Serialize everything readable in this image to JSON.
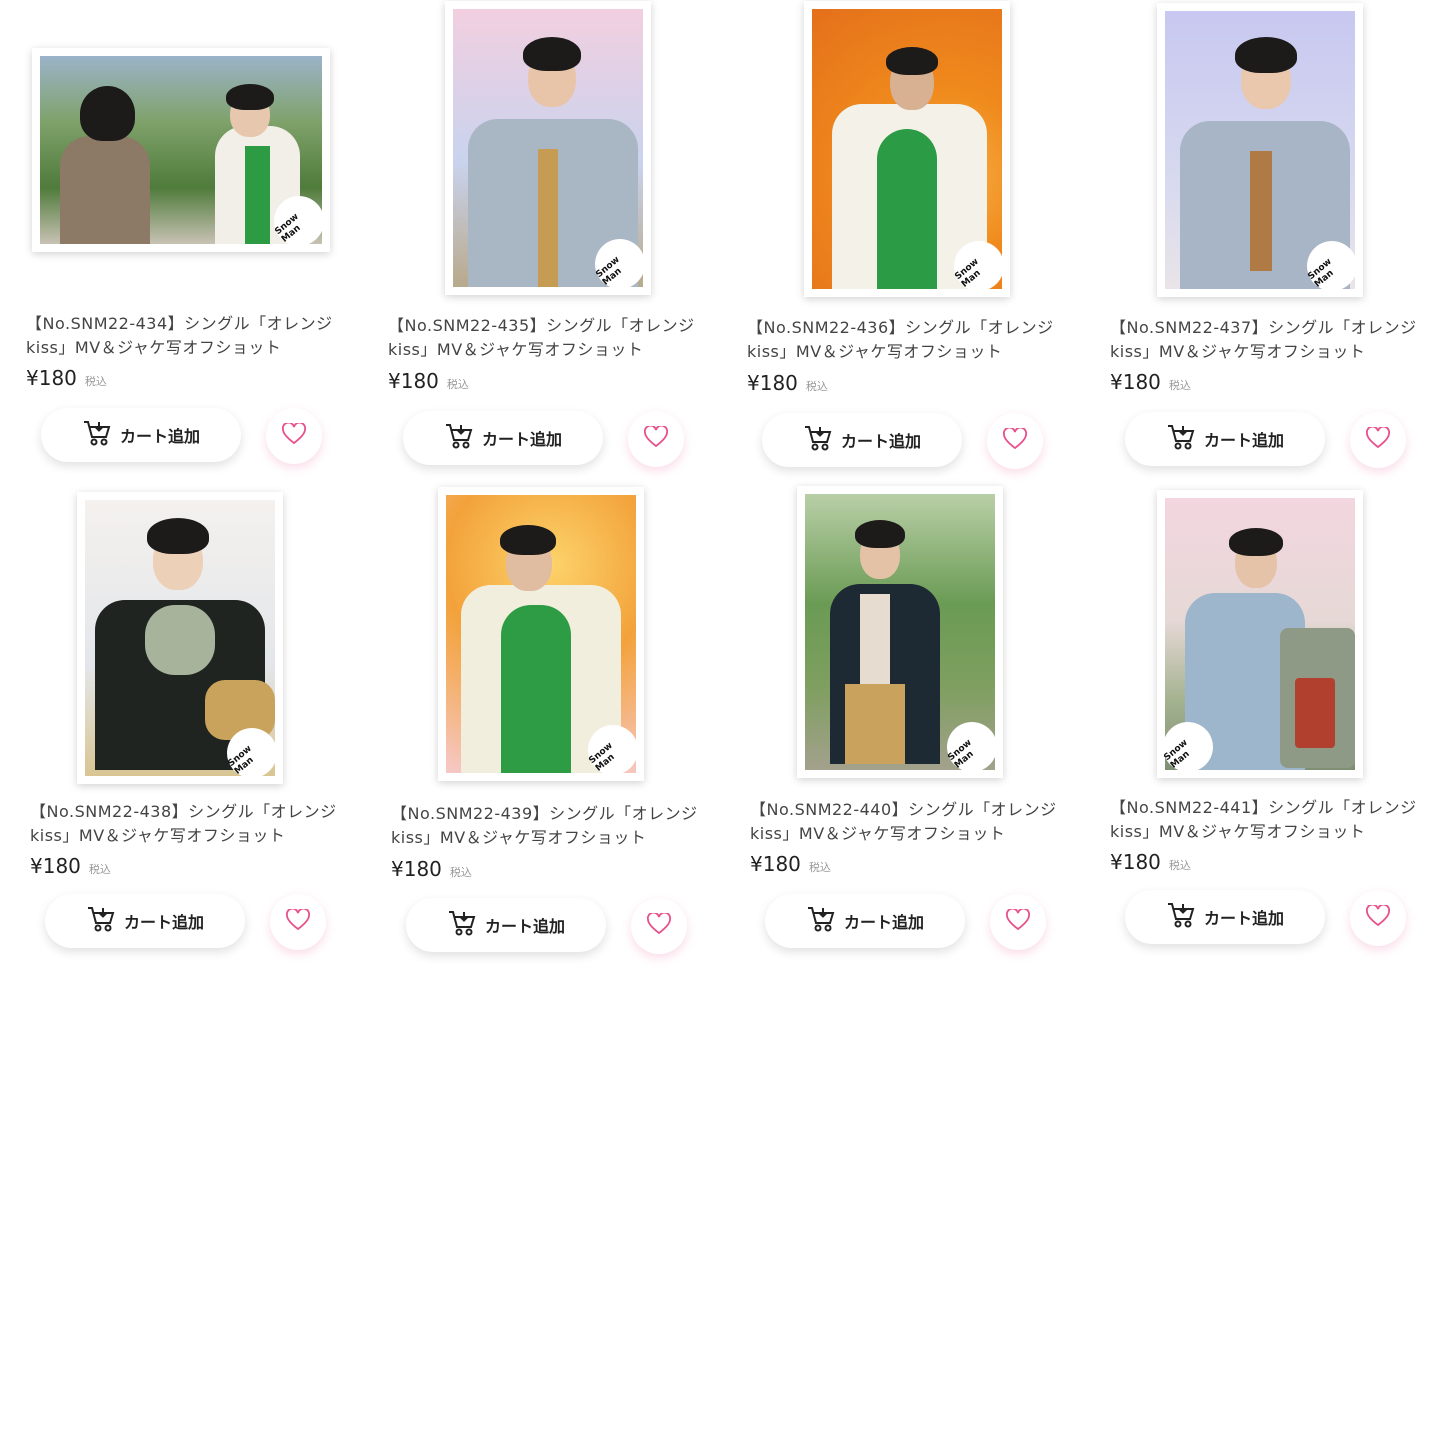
{
  "products": [
    {
      "title": "【No.SNM22-434】シングル「オレンジkiss」MV＆ジャケ写オフショット",
      "price": "¥180",
      "tax": "税込",
      "cart_label": "カート追加",
      "scene": "garden",
      "logo": "Snow Man"
    },
    {
      "title": "【No.SNM22-435】シングル「オレンジkiss」MV＆ジャケ写オフショット",
      "price": "¥180",
      "tax": "税込",
      "cart_label": "カート追加",
      "scene": "denim-pink",
      "logo": "Snow Man"
    },
    {
      "title": "【No.SNM22-436】シングル「オレンジkiss」MV＆ジャケ写オフショット",
      "price": "¥180",
      "tax": "税込",
      "cart_label": "カート追加",
      "scene": "orange-green",
      "logo": "Snow Man"
    },
    {
      "title": "【No.SNM22-437】シングル「オレンジkiss」MV＆ジャケ写オフショット",
      "price": "¥180",
      "tax": "税込",
      "cart_label": "カート追加",
      "scene": "denim-blue",
      "logo": "Snow Man"
    },
    {
      "title": "【No.SNM22-438】シングル「オレンジkiss」MV＆ジャケ写オフショット",
      "price": "¥180",
      "tax": "税込",
      "cart_label": "カート追加",
      "scene": "black-floral",
      "logo": "Snow Man"
    },
    {
      "title": "【No.SNM22-439】シングル「オレンジkiss」MV＆ジャケ写オフショット",
      "price": "¥180",
      "tax": "税込",
      "cart_label": "カート追加",
      "scene": "orange-crouch",
      "logo": "Snow Man"
    },
    {
      "title": "【No.SNM22-440】シングル「オレンジkiss」MV＆ジャケ写オフショット",
      "price": "¥180",
      "tax": "税込",
      "cart_label": "カート追加",
      "scene": "roadside",
      "logo": "Snow Man"
    },
    {
      "title": "【No.SNM22-441】シングル「オレンジkiss」MV＆ジャケ写オフショット",
      "price": "¥180",
      "tax": "税込",
      "cart_label": "カート追加",
      "scene": "palm-car",
      "logo": "Snow Man"
    }
  ],
  "icons": {
    "cart": "cart-icon",
    "favorite": "heart-icon"
  },
  "colors": {
    "heart": "#e8508c",
    "text": "#444444"
  }
}
